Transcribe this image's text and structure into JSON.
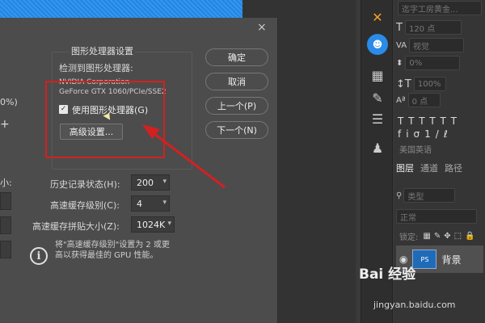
{
  "dialog": {
    "close": "×",
    "left_partial": {
      "pct": "0%)",
      "plus": "+",
      "colon": "小:"
    },
    "group_title": "图形处理器设置",
    "detected_label": "检测到图形处理器:",
    "gpu_vendor": "NVIDIA Corporation",
    "gpu_model": "GeForce GTX 1060/PCIe/SSE2",
    "use_gpu_label": "使用图形处理器(G)",
    "use_gpu_checked": "✓",
    "advanced_button": "高级设置...",
    "buttons": {
      "ok": "确定",
      "cancel": "取消",
      "prev": "上一个(P)",
      "next": "下一个(N)"
    },
    "history_label": "历史记录状态(H):",
    "history_value": "200",
    "cache_levels_label": "高速缓存级别(C):",
    "cache_levels_value": "4",
    "tile_size_label": "高速缓存拼贴大小(Z):",
    "tile_size_value": "1024K",
    "hint_line1": "将\"高速缓存级别\"设置为 2 或更",
    "hint_line2": "高以获得最佳的 GPU 性能。"
  },
  "right_panel": {
    "font_name": "迄字工房黄金...",
    "font_size": "120 点",
    "font_style": "视觉",
    "tracking": "0%",
    "scale": "100%",
    "baseline": "0 点",
    "language": "美国英语",
    "tabs": [
      "图层",
      "通道",
      "路径"
    ],
    "kind": "类型",
    "blend": "正常",
    "lock": "锁定:",
    "layer_name": "背景",
    "thumb_text": "PS"
  },
  "watermark": {
    "brand": "Bai 经验",
    "url": "jingyan.baidu.com"
  },
  "colors": {
    "annotation_red": "#d42020",
    "dialog_bg": "#4c4c4c",
    "accent_blue": "#2a8be8"
  }
}
